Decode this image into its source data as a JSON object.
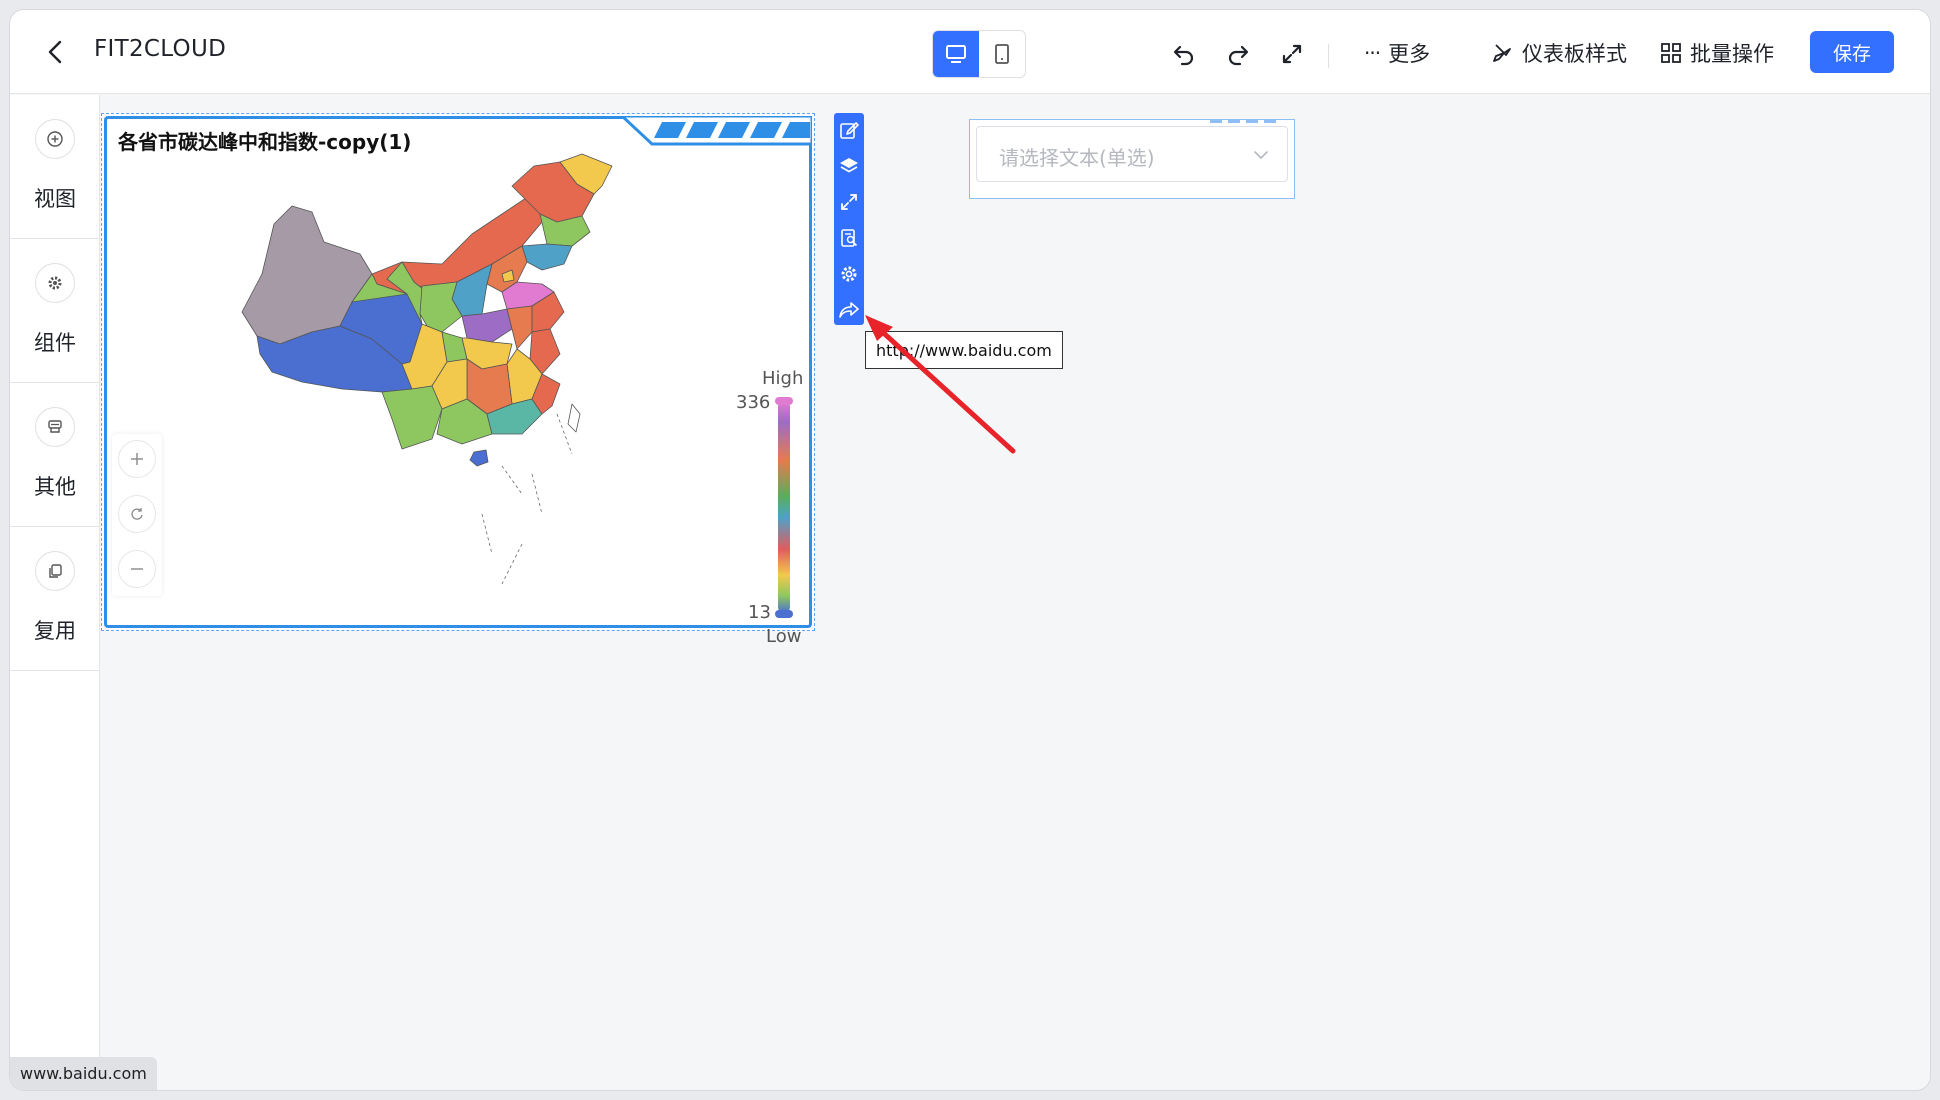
{
  "header": {
    "title": "FIT2CLOUD",
    "more_label": "更多",
    "style_label": "仪表板样式",
    "batch_label": "批量操作",
    "save_label": "保存"
  },
  "sidebar": {
    "items": [
      {
        "label": "视图",
        "icon": "plus-circle-icon"
      },
      {
        "label": "组件",
        "icon": "gear-icon"
      },
      {
        "label": "其他",
        "icon": "stamp-icon"
      },
      {
        "label": "复用",
        "icon": "copy-icon"
      }
    ]
  },
  "chart": {
    "title": "各省市碳达峰中和指数-copy(1)",
    "legend_high_label": "High",
    "legend_low_label": "Low",
    "legend_max": "336",
    "legend_min": "13"
  },
  "chart_data": {
    "type": "map",
    "title": "各省市碳达峰中和指数-copy(1)",
    "region": "China provinces",
    "visual_map": {
      "min": 13,
      "max": 336,
      "high_label": "High",
      "low_label": "Low"
    }
  },
  "tooltip": {
    "text": "http://www.baidu.com"
  },
  "select": {
    "placeholder": "请选择文本(单选)"
  },
  "status_bar": {
    "url": "www.baidu.com"
  },
  "colors": {
    "primary": "#3370ff",
    "card_border": "#2f8fe6",
    "annotation_arrow": "#e8232a"
  }
}
